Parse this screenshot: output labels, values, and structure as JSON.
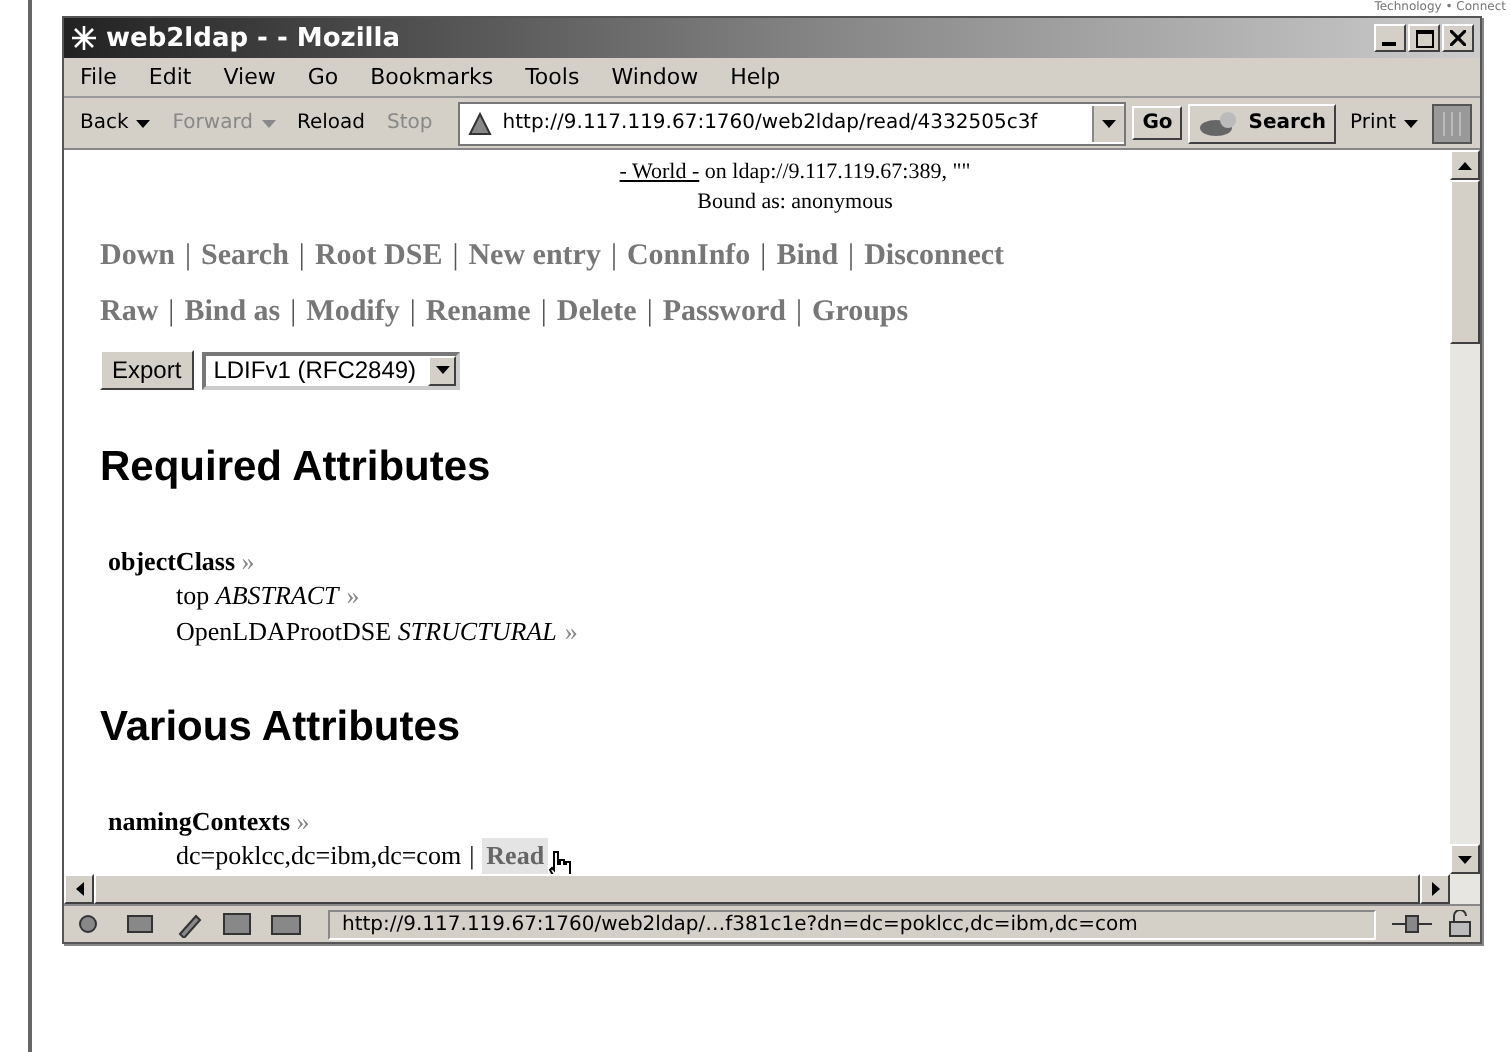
{
  "background_text": "Technology • Connect",
  "window": {
    "title": "web2ldap - - Mozilla"
  },
  "menu": [
    "File",
    "Edit",
    "View",
    "Go",
    "Bookmarks",
    "Tools",
    "Window",
    "Help"
  ],
  "toolbar": {
    "buttons": [
      {
        "label": "Back",
        "disabled": false,
        "dropdown": true
      },
      {
        "label": "Forward",
        "disabled": true,
        "dropdown": true
      },
      {
        "label": "Reload",
        "disabled": false,
        "dropdown": false
      },
      {
        "label": "Stop",
        "disabled": true,
        "dropdown": false
      }
    ],
    "address": "http://9.117.119.67:1760/web2ldap/read/4332505c3f",
    "go": "Go",
    "search": "Search",
    "print": "Print"
  },
  "page": {
    "world_link": "- World -",
    "server": "on ldap://9.117.119.67:389, \"\"",
    "bound": "Bound as: anonymous",
    "separator": "|",
    "nav_rows": [
      [
        "Down",
        "Search",
        "Root DSE",
        "New entry",
        "ConnInfo",
        "Bind",
        "Disconnect"
      ],
      [
        "Raw",
        "Bind as",
        "Modify",
        "Rename",
        "Delete",
        "Password",
        "Groups"
      ]
    ],
    "export_button": "Export",
    "format": "LDIFv1 (RFC2849)",
    "sections": [
      {
        "heading": "Required Attributes",
        "attributes": [
          {
            "name": "objectClass",
            "more": "»",
            "values": [
              {
                "text": "top",
                "type": "ABSTRACT",
                "more": "»"
              },
              {
                "text": "OpenLDAProotDSE",
                "type": "STRUCTURAL",
                "more": "»"
              }
            ]
          }
        ]
      },
      {
        "heading": "Various Attributes",
        "attributes": [
          {
            "name": "namingContexts",
            "more": "»",
            "values": [
              {
                "text": "dc=poklcc,dc=ibm,dc=com",
                "separator": "|",
                "link": "Read",
                "hovered": true
              }
            ]
          }
        ]
      }
    ]
  },
  "status": {
    "url": "http://9.117.119.67:1760/web2ldap/…f381c1e?dn=dc=poklcc,dc=ibm,dc=com"
  }
}
